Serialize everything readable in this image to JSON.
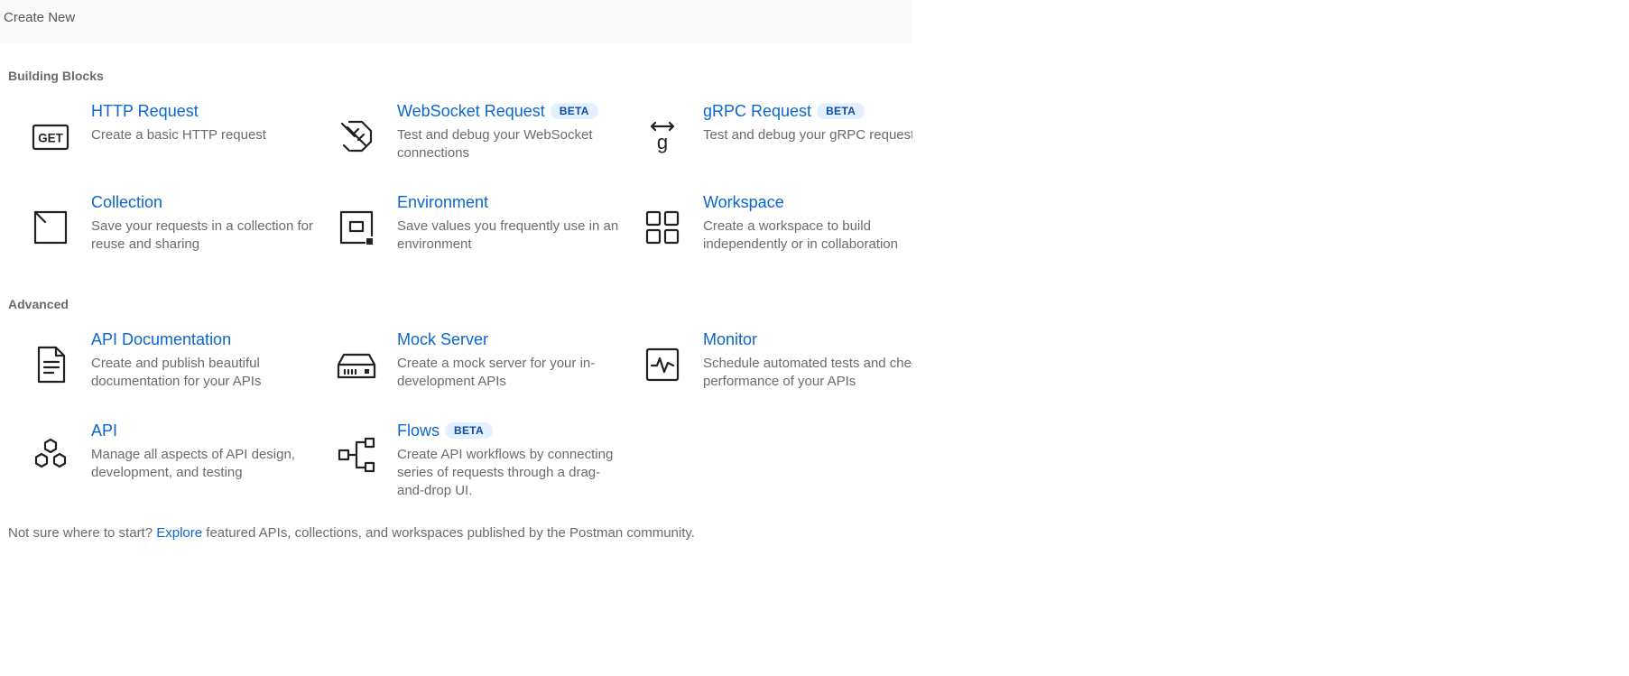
{
  "header": {
    "title": "Create New"
  },
  "sections": {
    "building_blocks": {
      "title": "Building Blocks"
    },
    "advanced": {
      "title": "Advanced"
    }
  },
  "items": {
    "http_request": {
      "title": "HTTP Request",
      "desc": "Create a basic HTTP request",
      "icon": "get-request-icon"
    },
    "websocket_request": {
      "title": "WebSocket Request",
      "badge": "BETA",
      "desc": "Test and debug your WebSocket connections",
      "icon": "websocket-icon"
    },
    "grpc_request": {
      "title": "gRPC Request",
      "badge": "BETA",
      "desc": "Test and debug your gRPC request",
      "icon": "grpc-icon"
    },
    "collection": {
      "title": "Collection",
      "desc": "Save your requests in a collection for reuse and sharing",
      "icon": "collection-icon"
    },
    "environment": {
      "title": "Environment",
      "desc": "Save values you frequently use in an environment",
      "icon": "environment-icon"
    },
    "workspace": {
      "title": "Workspace",
      "desc": "Create a workspace to build independently or in collaboration",
      "icon": "workspace-icon"
    },
    "api_documentation": {
      "title": "API Documentation",
      "desc": "Create and publish beautiful documentation for your APIs",
      "icon": "document-icon"
    },
    "mock_server": {
      "title": "Mock Server",
      "desc": "Create a mock server for your in-development APIs",
      "icon": "server-icon"
    },
    "monitor": {
      "title": "Monitor",
      "desc": "Schedule automated tests and check performance of your APIs",
      "icon": "monitor-icon"
    },
    "api": {
      "title": "API",
      "desc": "Manage all aspects of API design, development, and testing",
      "icon": "api-hexagons-icon"
    },
    "flows": {
      "title": "Flows",
      "badge": "BETA",
      "desc": "Create API workflows by connecting series of requests through a drag-and-drop UI.",
      "icon": "flows-icon"
    }
  },
  "footer": {
    "prefix": "Not sure where to start?",
    "link": "Explore",
    "suffix": "featured APIs, collections, and workspaces published by the Postman community."
  },
  "colors": {
    "accent": "#0b66d0",
    "badge_bg": "#e4efff",
    "muted_text": "#6b6b6b",
    "header_bg": "#f9f9f9"
  }
}
